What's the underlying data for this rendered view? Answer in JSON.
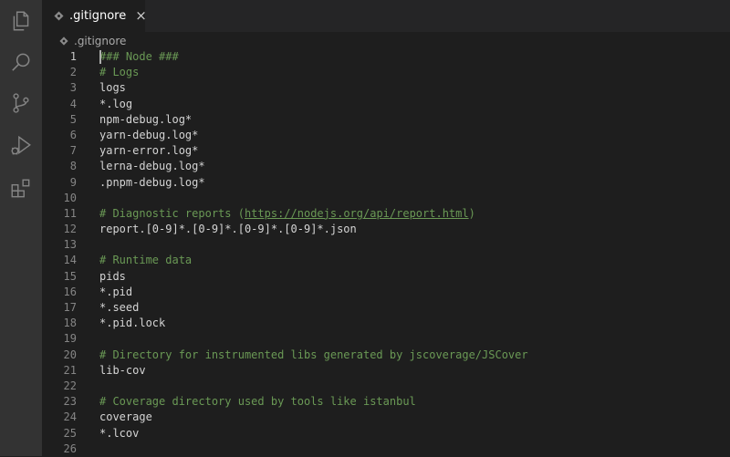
{
  "activity_bar": {
    "items": [
      {
        "name": "explorer-icon"
      },
      {
        "name": "search-icon"
      },
      {
        "name": "source-control-icon"
      },
      {
        "name": "run-debug-icon"
      },
      {
        "name": "extensions-icon"
      }
    ]
  },
  "tab": {
    "label": ".gitignore",
    "close": "×",
    "icon": "settings-file-icon"
  },
  "breadcrumb": {
    "label": ".gitignore",
    "icon": "settings-file-icon"
  },
  "editor": {
    "active_line": 1,
    "lines": [
      {
        "n": "1",
        "text": "### Node ###",
        "comment": true
      },
      {
        "n": "2",
        "text": "# Logs",
        "comment": true
      },
      {
        "n": "3",
        "text": "logs",
        "comment": false
      },
      {
        "n": "4",
        "text": "*.log",
        "comment": false
      },
      {
        "n": "5",
        "text": "npm-debug.log*",
        "comment": false
      },
      {
        "n": "6",
        "text": "yarn-debug.log*",
        "comment": false
      },
      {
        "n": "7",
        "text": "yarn-error.log*",
        "comment": false
      },
      {
        "n": "8",
        "text": "lerna-debug.log*",
        "comment": false
      },
      {
        "n": "9",
        "text": ".pnpm-debug.log*",
        "comment": false
      },
      {
        "n": "10",
        "text": "",
        "comment": false
      },
      {
        "n": "11",
        "text": "# Diagnostic reports (",
        "link": "https://nodejs.org/api/report.html",
        "suffix": ")",
        "comment": true
      },
      {
        "n": "12",
        "text": "report.[0-9]*.[0-9]*.[0-9]*.[0-9]*.json",
        "comment": false
      },
      {
        "n": "13",
        "text": "",
        "comment": false
      },
      {
        "n": "14",
        "text": "# Runtime data",
        "comment": true
      },
      {
        "n": "15",
        "text": "pids",
        "comment": false
      },
      {
        "n": "16",
        "text": "*.pid",
        "comment": false
      },
      {
        "n": "17",
        "text": "*.seed",
        "comment": false
      },
      {
        "n": "18",
        "text": "*.pid.lock",
        "comment": false
      },
      {
        "n": "19",
        "text": "",
        "comment": false
      },
      {
        "n": "20",
        "text": "# Directory for instrumented libs generated by jscoverage/JSCover",
        "comment": true
      },
      {
        "n": "21",
        "text": "lib-cov",
        "comment": false
      },
      {
        "n": "22",
        "text": "",
        "comment": false
      },
      {
        "n": "23",
        "text": "# Coverage directory used by tools like istanbul",
        "comment": true
      },
      {
        "n": "24",
        "text": "coverage",
        "comment": false
      },
      {
        "n": "25",
        "text": "*.lcov",
        "comment": false
      },
      {
        "n": "26",
        "text": "",
        "comment": false
      }
    ]
  },
  "colors": {
    "comment": "#6a9955",
    "text": "#d4d4d4",
    "line_number": "#858585",
    "background": "#1e1e1e",
    "activity_bar": "#333333"
  }
}
